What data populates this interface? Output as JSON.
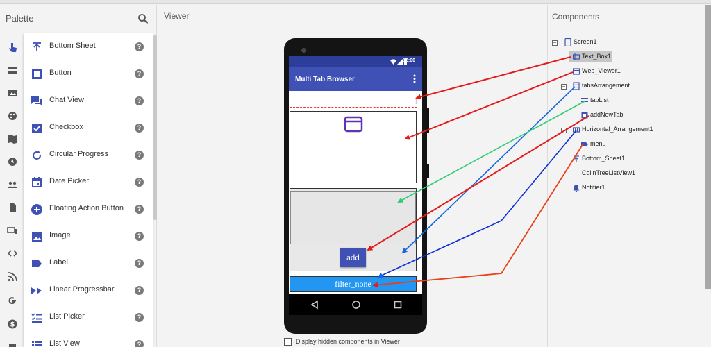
{
  "palette": {
    "title": "Palette",
    "items": [
      {
        "label": "Bottom Sheet",
        "icon": "bottom-sheet-icon"
      },
      {
        "label": "Button",
        "icon": "button-icon"
      },
      {
        "label": "Chat View",
        "icon": "chat-view-icon"
      },
      {
        "label": "Checkbox",
        "icon": "checkbox-icon"
      },
      {
        "label": "Circular Progress",
        "icon": "circular-progress-icon"
      },
      {
        "label": "Date Picker",
        "icon": "date-picker-icon"
      },
      {
        "label": "Floating Action Button",
        "icon": "floating-action-button-icon"
      },
      {
        "label": "Image",
        "icon": "image-icon"
      },
      {
        "label": "Label",
        "icon": "label-icon"
      },
      {
        "label": "Linear Progressbar",
        "icon": "linear-progressbar-icon"
      },
      {
        "label": "List Picker",
        "icon": "list-picker-icon"
      },
      {
        "label": "List View",
        "icon": "list-view-icon"
      }
    ],
    "help_glyph": "?"
  },
  "viewer": {
    "title": "Viewer",
    "status_time": "12:00",
    "app_title": "Multi Tab Browser",
    "add_label": "add",
    "filter_label": "filter_none",
    "hidden_components_label": "Display hidden components in Viewer"
  },
  "components": {
    "title": "Components",
    "tree": [
      {
        "label": "Screen1",
        "icon": "screen-icon"
      },
      {
        "label": "Text_Box1",
        "icon": "textbox-icon"
      },
      {
        "label": "Web_Viewer1",
        "icon": "webviewer-icon"
      },
      {
        "label": "tabsArrangement",
        "icon": "vertical-arrangement-icon"
      },
      {
        "label": "tabList",
        "icon": "listview-icon"
      },
      {
        "label": "addNewTab",
        "icon": "button-icon"
      },
      {
        "label": "Horizontal_Arrangement1",
        "icon": "horizontal-arrangement-icon"
      },
      {
        "label": "menu",
        "icon": "label-icon"
      },
      {
        "label": "Bottom_Sheet1",
        "icon": "bottom-sheet-icon"
      },
      {
        "label": "ColinTreeListView1",
        "icon": "none"
      },
      {
        "label": "Notifier1",
        "icon": "notifier-icon"
      }
    ]
  },
  "colors": {
    "accent": "#3f51b5",
    "statusbar": "#2c3e9a",
    "filter_button": "#2196f3",
    "arrow_red": "#e51b1b",
    "arrow_blue": "#1565e0",
    "arrow_green": "#2ecc71"
  }
}
